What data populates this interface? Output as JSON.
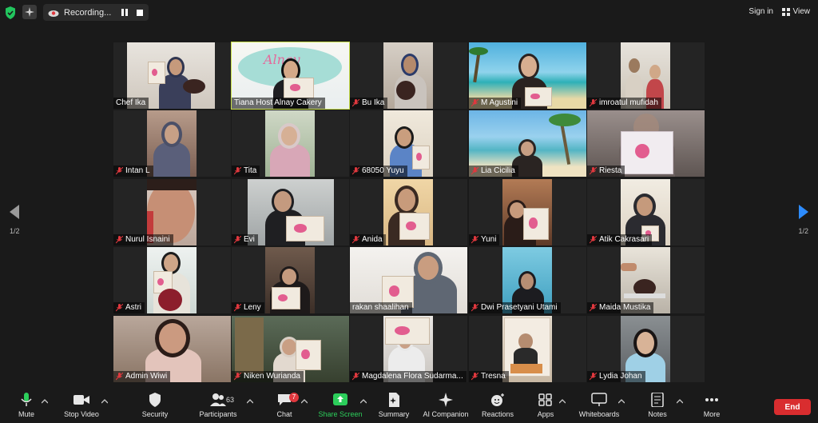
{
  "topbar": {
    "recording_label": "Recording...",
    "signin_label": "Sign in",
    "view_label": "View"
  },
  "pagination": {
    "left": "1/2",
    "right": "1/2"
  },
  "tiles": [
    {
      "name": "Chef Ika",
      "muted": false
    },
    {
      "name": "Tiana Host Alnay Cakery",
      "muted": false,
      "active": true
    },
    {
      "name": "Bu Ika",
      "muted": true
    },
    {
      "name": "M Agustini",
      "muted": true
    },
    {
      "name": "imroatul mufidah",
      "muted": true
    },
    {
      "name": "Intan L",
      "muted": true
    },
    {
      "name": "Tita",
      "muted": true
    },
    {
      "name": "68050 Yuyu",
      "muted": true
    },
    {
      "name": "Lia Cicilia",
      "muted": true
    },
    {
      "name": "Riesta",
      "muted": true
    },
    {
      "name": "Nurul Isnaini",
      "muted": true
    },
    {
      "name": "Evi",
      "muted": true
    },
    {
      "name": "Anida",
      "muted": true
    },
    {
      "name": "Yuni",
      "muted": true
    },
    {
      "name": "Atik Cakrasari",
      "muted": true
    },
    {
      "name": "Astri",
      "muted": true
    },
    {
      "name": "Leny",
      "muted": true
    },
    {
      "name": "rakan shaalihan",
      "muted": false
    },
    {
      "name": "Dwi Prasetyani Utami",
      "muted": true
    },
    {
      "name": "Maida Mustika",
      "muted": true
    },
    {
      "name": "Admin Wiwi",
      "muted": true
    },
    {
      "name": "Niken Wurianda",
      "muted": true
    },
    {
      "name": "Magdalena Flora Sudarma...",
      "muted": true
    },
    {
      "name": "Tresna",
      "muted": true
    },
    {
      "name": "Lydia Johan",
      "muted": true
    }
  ],
  "toolbar": {
    "mute": "Mute",
    "stop_video": "Stop Video",
    "security": "Security",
    "participants": "Participants",
    "participants_count": "63",
    "chat": "Chat",
    "chat_badge": "7",
    "share_screen": "Share Screen",
    "summary": "Summary",
    "ai_companion": "AI Companion",
    "reactions": "Reactions",
    "apps": "Apps",
    "whiteboards": "Whiteboards",
    "notes": "Notes",
    "more": "More",
    "end": "End"
  },
  "colors": {
    "active_speaker": "#c9e04a",
    "share_green": "#2cce5b",
    "end_red": "#d92d2f",
    "security_green": "#22c55e",
    "next_arrow_blue": "#2d8cff"
  }
}
